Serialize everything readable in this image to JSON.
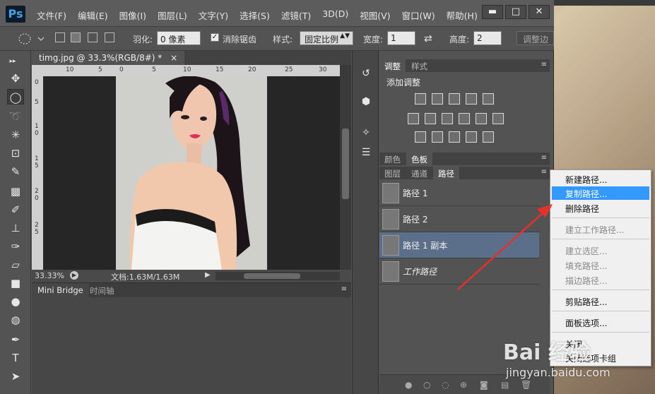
{
  "app": {
    "logo": "Ps",
    "menu": [
      "文件(F)",
      "编辑(E)",
      "图像(I)",
      "图层(L)",
      "文字(Y)",
      "选择(S)",
      "滤镜(T)",
      "3D(D)",
      "视图(V)",
      "窗口(W)",
      "帮助(H)"
    ],
    "window_controls": {
      "minimize": "▬",
      "maximize": "□",
      "close": "✕"
    }
  },
  "options": {
    "feather_label": "羽化:",
    "feather_value": "0 像素",
    "antialias_label": "消除锯齿",
    "style_label": "样式:",
    "style_value": "固定比例",
    "width_label": "宽度:",
    "width_value": "1",
    "height_label": "高度:",
    "height_value": "2",
    "refine_label": "调整边"
  },
  "document": {
    "tab_title": "timg.jpg @ 33.3%(RGB/8#) *",
    "tab_close": "×",
    "zoom": "33.33%",
    "doc_info": "文档:1.63M/1.63M",
    "ruler_h": [
      "10",
      "5",
      "0",
      "5",
      "10",
      "15",
      "20",
      "25",
      "30"
    ],
    "ruler_v": [
      "0",
      "5",
      "1",
      "0",
      "1",
      "5",
      "2",
      "0",
      "2",
      "5"
    ]
  },
  "mini_bridge": {
    "tabs": [
      "Mini Bridge",
      "时间轴"
    ]
  },
  "adjustments": {
    "tabs": [
      "调整",
      "样式"
    ],
    "title": "添加调整"
  },
  "color_panel": {
    "tabs": [
      "颜色",
      "色板"
    ]
  },
  "layers_panel": {
    "tabs": [
      "图层",
      "通道",
      "路径"
    ],
    "paths": [
      {
        "name": "路径 1",
        "selected": false,
        "italic": false
      },
      {
        "name": "路径 2",
        "selected": false,
        "italic": false
      },
      {
        "name": "路径 1 副本",
        "selected": true,
        "italic": false
      },
      {
        "name": "工作路径",
        "selected": false,
        "italic": true
      }
    ]
  },
  "context_menu": {
    "items": [
      {
        "label": "新建路径...",
        "disabled": false,
        "highlighted": false
      },
      {
        "label": "复制路径...",
        "disabled": false,
        "highlighted": true
      },
      {
        "label": "删除路径",
        "disabled": false,
        "highlighted": false
      },
      {
        "label": "建立工作路径...",
        "disabled": true,
        "highlighted": false
      },
      {
        "label": "建立选区...",
        "disabled": true,
        "highlighted": false
      },
      {
        "label": "填充路径...",
        "disabled": true,
        "highlighted": false
      },
      {
        "label": "描边路径...",
        "disabled": true,
        "highlighted": false
      },
      {
        "label": "剪贴路径...",
        "disabled": false,
        "highlighted": false
      },
      {
        "label": "面板选项...",
        "disabled": false,
        "highlighted": false
      },
      {
        "label": "关闭",
        "disabled": false,
        "highlighted": false
      },
      {
        "label": "关闭选项卡组",
        "disabled": false,
        "highlighted": false
      }
    ]
  },
  "watermark": {
    "line1": "Bai 经验",
    "line2": "jingyan.baidu.com"
  },
  "colors": {
    "accent_highlight": "#3399ff",
    "selected_path_row": "#5c6f8a",
    "annotation_arrow": "#e8302a"
  }
}
